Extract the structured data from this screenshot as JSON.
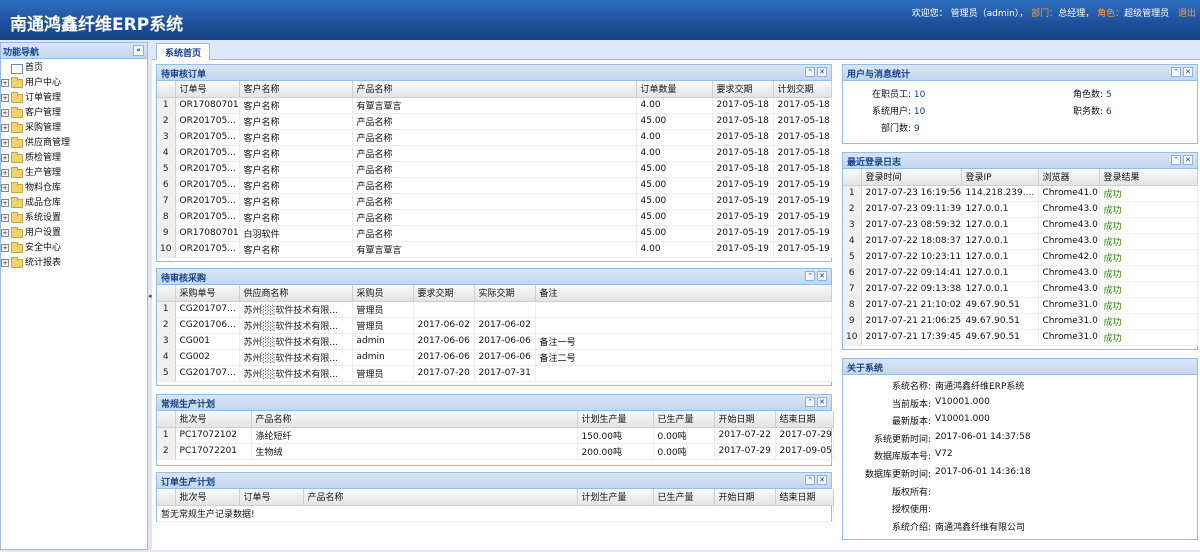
{
  "app": {
    "title": "南通鸿鑫纤维ERP系统"
  },
  "userbar": {
    "welcome": "欢迎您：",
    "user": "管理员（admin）",
    "dept_label": "部门：",
    "dept": "总经理",
    "role_label": "角色：",
    "role": "超级管理员",
    "logout": "退出"
  },
  "sidebar": {
    "title": "功能导航",
    "items": [
      {
        "label": "首页",
        "type": "page"
      },
      {
        "label": "用户中心",
        "type": "folder"
      },
      {
        "label": "订单管理",
        "type": "folder"
      },
      {
        "label": "客户管理",
        "type": "folder"
      },
      {
        "label": "采购管理",
        "type": "folder"
      },
      {
        "label": "供应商管理",
        "type": "folder"
      },
      {
        "label": "质检管理",
        "type": "folder"
      },
      {
        "label": "生产管理",
        "type": "folder"
      },
      {
        "label": "物料仓库",
        "type": "folder"
      },
      {
        "label": "成品仓库",
        "type": "folder"
      },
      {
        "label": "系统设置",
        "type": "folder"
      },
      {
        "label": "用户设置",
        "type": "folder"
      },
      {
        "label": "安全中心",
        "type": "folder"
      },
      {
        "label": "统计报表",
        "type": "folder"
      }
    ]
  },
  "tabs": [
    {
      "label": "系统首页"
    }
  ],
  "pending_orders": {
    "title": "待审核订单",
    "columns": [
      "订单号",
      "客户名称",
      "产品名称",
      "订单数量",
      "要求交期",
      "计划交期"
    ],
    "rows": [
      [
        "1",
        "OR17080701",
        "客户名称",
        "有覃言覃言",
        "4.00",
        "2017-05-18",
        "2017-05-18"
      ],
      [
        "2",
        "OR201705...",
        "客户名称",
        "产品名称",
        "45.00",
        "2017-05-18",
        "2017-05-18"
      ],
      [
        "3",
        "OR201705...",
        "客户名称",
        "产品名称",
        "4.00",
        "2017-05-18",
        "2017-05-18"
      ],
      [
        "4",
        "OR201705...",
        "客户名称",
        "产品名称",
        "4.00",
        "2017-05-18",
        "2017-05-18"
      ],
      [
        "5",
        "OR201705...",
        "客户名称",
        "产品名称",
        "45.00",
        "2017-05-18",
        "2017-05-18"
      ],
      [
        "6",
        "OR201705...",
        "客户名称",
        "产品名称",
        "45.00",
        "2017-05-19",
        "2017-05-19"
      ],
      [
        "7",
        "OR201705...",
        "客户名称",
        "产品名称",
        "45.00",
        "2017-05-19",
        "2017-05-19"
      ],
      [
        "8",
        "OR201705...",
        "客户名称",
        "产品名称",
        "45.00",
        "2017-05-19",
        "2017-05-19"
      ],
      [
        "9",
        "OR17080701",
        "白羽软件",
        "产品名称",
        "45.00",
        "2017-05-19",
        "2017-05-19"
      ],
      [
        "10",
        "OR201705...",
        "客户名称",
        "有覃言覃言",
        "4.00",
        "2017-05-19",
        "2017-05-19"
      ]
    ]
  },
  "pending_purchase": {
    "title": "待审核采购",
    "columns": [
      "采购单号",
      "供应商名称",
      "采购员",
      "要求交期",
      "实际交期",
      "备注"
    ],
    "rows": [
      [
        "1",
        "CG201707...",
        "苏州░░软件技术有限...",
        "管理员",
        "",
        "",
        ""
      ],
      [
        "2",
        "CG201706...",
        "苏州░░软件技术有限...",
        "管理员",
        "2017-06-02",
        "2017-06-02",
        ""
      ],
      [
        "3",
        "CG001",
        "苏州░░软件技术有限...",
        "admin",
        "2017-06-06",
        "2017-06-06",
        "备注一号"
      ],
      [
        "4",
        "CG002",
        "苏州░░软件技术有限...",
        "admin",
        "2017-06-06",
        "2017-06-06",
        "备注二号"
      ],
      [
        "5",
        "CG201707...",
        "苏州░░软件技术有限...",
        "管理员",
        "2017-07-20",
        "2017-07-31",
        ""
      ]
    ]
  },
  "regular_plan": {
    "title": "常规生产计划",
    "columns": [
      "批次号",
      "产品名称",
      "计划生产量",
      "已生产量",
      "开始日期",
      "结束日期"
    ],
    "rows": [
      [
        "1",
        "PC17072102",
        "涤纶短纤",
        "150.00吨",
        "0.00吨",
        "2017-07-22",
        "2017-07-29"
      ],
      [
        "2",
        "PC17072201",
        "生物绒",
        "200.00吨",
        "0.00吨",
        "2017-07-29",
        "2017-09-05"
      ]
    ]
  },
  "order_plan": {
    "title": "订单生产计划",
    "columns": [
      "批次号",
      "订单号",
      "产品名称",
      "计划生产量",
      "已生产量",
      "开始日期",
      "结束日期"
    ],
    "empty": "暂无常规生产记录数据!"
  },
  "user_stats": {
    "title": "用户与消息统计",
    "items": [
      {
        "label": "在职员工:",
        "value": "10"
      },
      {
        "label": "角色数:",
        "value": "5"
      },
      {
        "label": "系统用户:",
        "value": "10"
      },
      {
        "label": "职务数:",
        "value": "6"
      },
      {
        "label": "部门数:",
        "value": "9"
      }
    ]
  },
  "login_log": {
    "title": "最近登录日志",
    "columns": [
      "登录时间",
      "登录IP",
      "浏览器",
      "登录结果"
    ],
    "rows": [
      [
        "1",
        "2017-07-23 16:19:56",
        "114.218.239....",
        "Chrome41.0",
        "成功"
      ],
      [
        "2",
        "2017-07-23 09:11:39",
        "127.0.0.1",
        "Chrome43.0",
        "成功"
      ],
      [
        "3",
        "2017-07-23 08:59:32",
        "127.0.0.1",
        "Chrome43.0",
        "成功"
      ],
      [
        "4",
        "2017-07-22 18:08:37",
        "127.0.0.1",
        "Chrome43.0",
        "成功"
      ],
      [
        "5",
        "2017-07-22 10:23:11",
        "127.0.0.1",
        "Chrome42.0",
        "成功"
      ],
      [
        "6",
        "2017-07-22 09:14:41",
        "127.0.0.1",
        "Chrome43.0",
        "成功"
      ],
      [
        "7",
        "2017-07-22 09:13:38",
        "127.0.0.1",
        "Chrome43.0",
        "成功"
      ],
      [
        "8",
        "2017-07-21 21:10:02",
        "49.67.90.51",
        "Chrome31.0",
        "成功"
      ],
      [
        "9",
        "2017-07-21 21:06:25",
        "49.67.90.51",
        "Chrome31.0",
        "成功"
      ],
      [
        "10",
        "2017-07-21 17:39:45",
        "49.67.90.51",
        "Chrome31.0",
        "成功"
      ]
    ]
  },
  "about": {
    "title": "关于系统",
    "items": [
      {
        "label": "系统名称:",
        "value": "南通鸿鑫纤维ERP系统"
      },
      {
        "label": "当前版本:",
        "value": "V10001.000"
      },
      {
        "label": "最新版本:",
        "value": "V10001.000"
      },
      {
        "label": "系统更新时间:",
        "value": "2017-06-01 14:37:58"
      },
      {
        "label": "数据库版本号:",
        "value": "V72"
      },
      {
        "label": "数据库更新时间:",
        "value": "2017-06-01 14:36:18"
      },
      {
        "label": "版权所有:",
        "value": ""
      },
      {
        "label": "授权使用:",
        "value": ""
      },
      {
        "label": "系统介绍:",
        "value": "南通鸿鑫纤维有限公司"
      }
    ]
  },
  "colors": {
    "header": "#1d4f9a",
    "panel_title": "#15428b",
    "border": "#99bbe8",
    "success": "#2a8a00",
    "highlight": "#ff9a2e"
  }
}
